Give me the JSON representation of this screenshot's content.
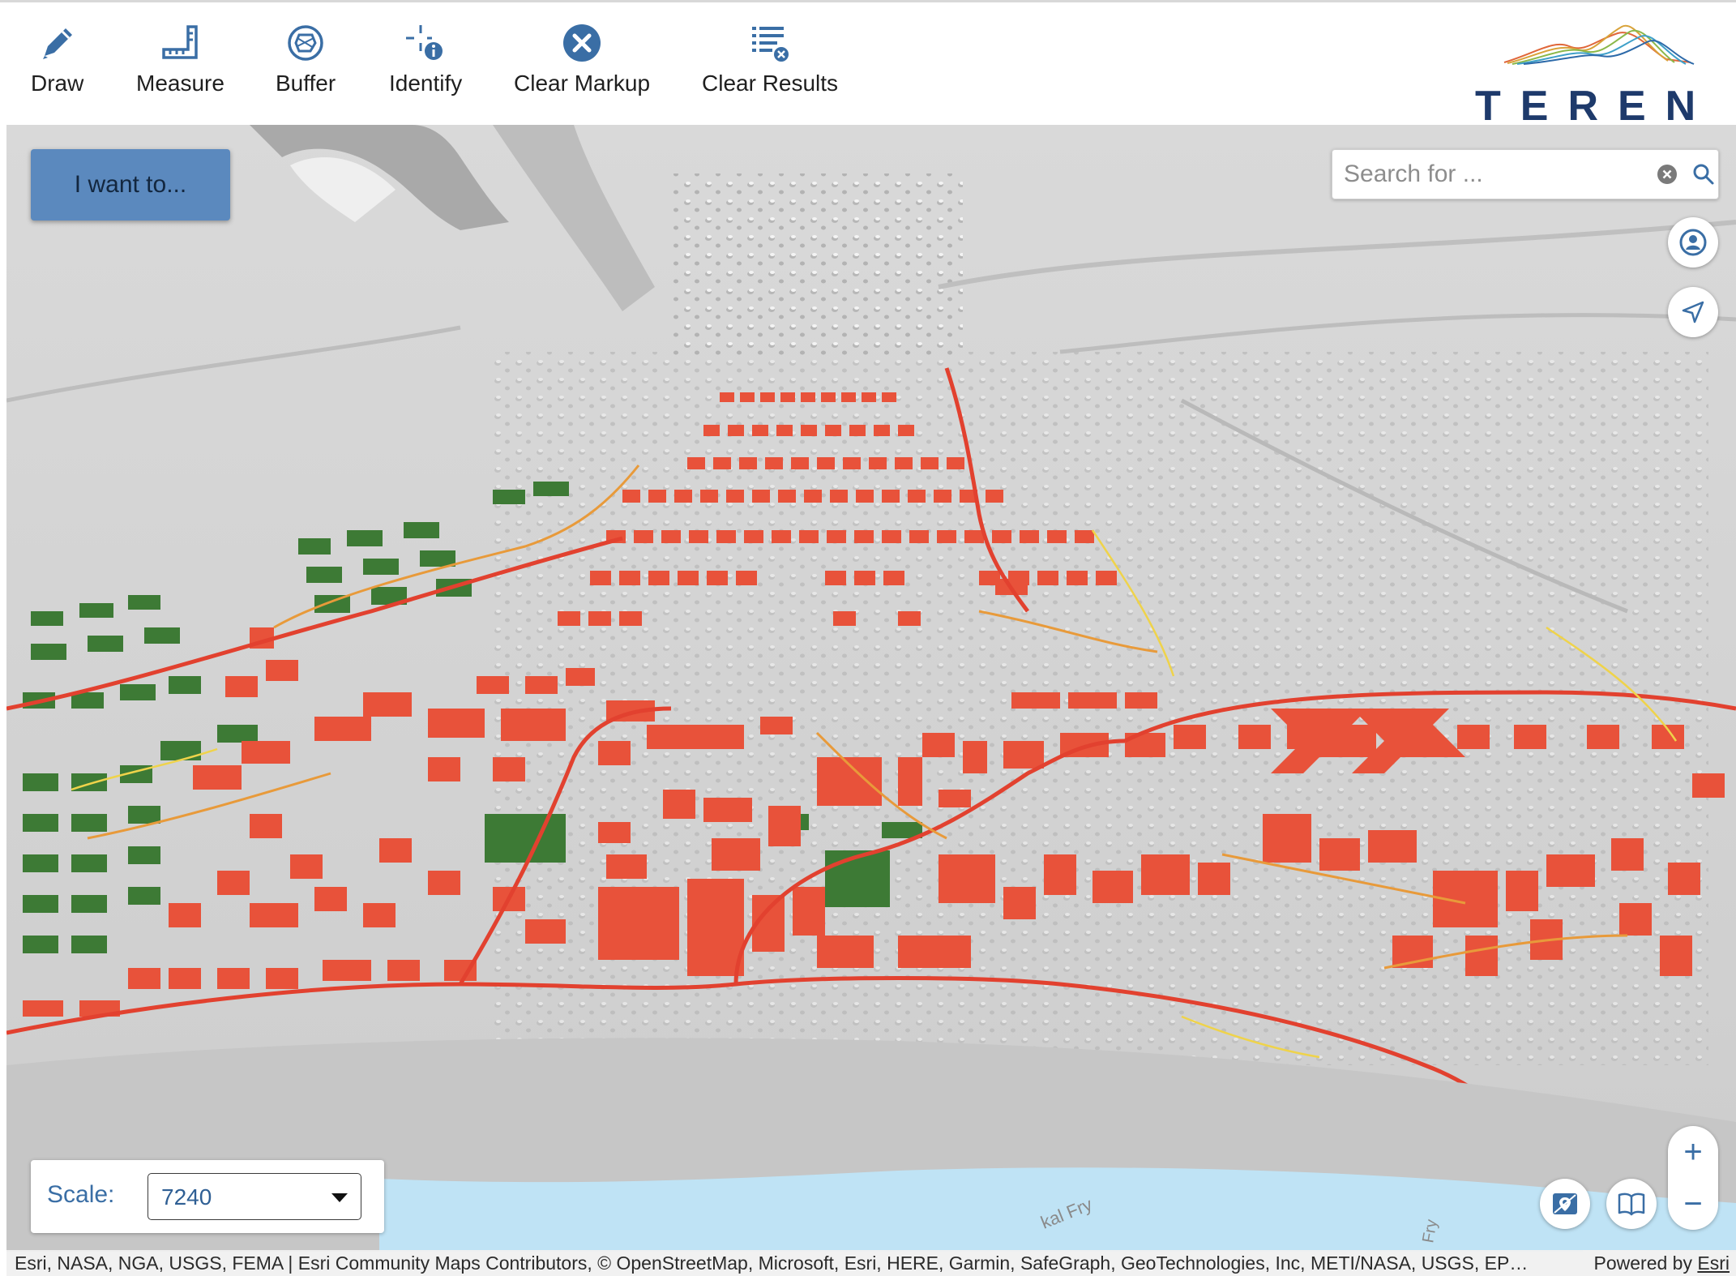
{
  "toolbar": {
    "draw_label": "Draw",
    "measure_label": "Measure",
    "buffer_label": "Buffer",
    "identify_label": "Identify",
    "clear_markup_label": "Clear Markup",
    "clear_results_label": "Clear Results"
  },
  "logo": {
    "text": "TEREN"
  },
  "map": {
    "i_want_to_label": "I want to...",
    "search": {
      "placeholder": "Search for ..."
    },
    "scale": {
      "label": "Scale:",
      "value": "7240"
    },
    "zoom": {
      "in_label": "+",
      "out_label": "−"
    },
    "street_labels": [
      "kal Fry",
      "Fry"
    ]
  },
  "attribution": {
    "text": "Esri, NASA, NGA, USGS, FEMA | Esri Community Maps Contributors, © OpenStreetMap, Microsoft, Esri, HERE, Garmin, SafeGraph, GeoTechnologies, Inc, METI/NASA, USGS, EP…",
    "powered_prefix": "Powered by ",
    "powered_link": "Esri"
  },
  "colors": {
    "accent": "#3a6ea5",
    "button_bg": "#5b89be",
    "building_red": "#e8523a",
    "building_green": "#3d7a35",
    "water": "#bfe3f5"
  },
  "icons": [
    "pencil-icon",
    "ruler-icon",
    "buffer-icon",
    "identify-icon",
    "clear-markup-icon",
    "clear-results-icon",
    "clear-search-icon",
    "search-icon",
    "user-location-icon",
    "navigate-icon",
    "basemap-icon",
    "bookmark-icon"
  ]
}
